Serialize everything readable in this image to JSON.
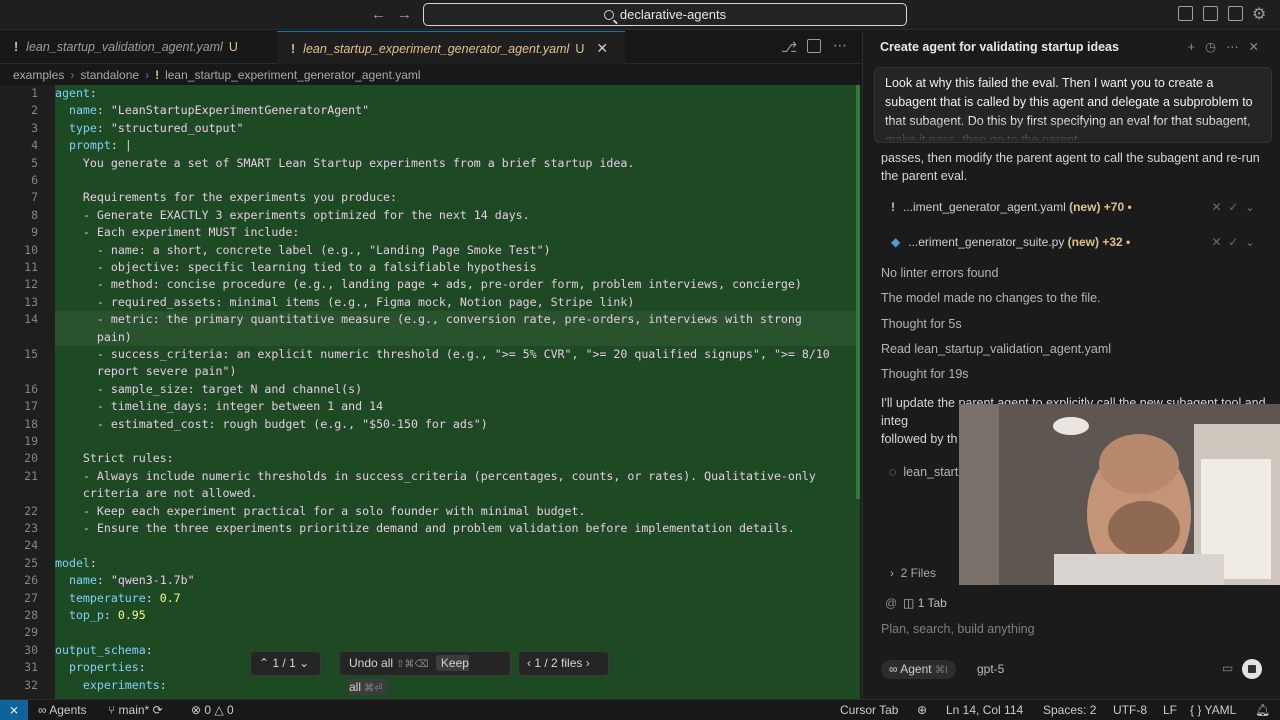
{
  "titlebar": {
    "search_text": "declarative-agents"
  },
  "tabs": [
    {
      "label": "lean_startup_validation_agent.yaml",
      "badge": "U"
    },
    {
      "label": "lean_startup_experiment_generator_agent.yaml",
      "badge": "U"
    }
  ],
  "breadcrumb": {
    "part1": "examples",
    "part2": "standalone",
    "file": "lean_startup_experiment_generator_agent.yaml"
  },
  "code_lines": [
    {
      "n": "1",
      "t": "agent:"
    },
    {
      "n": "2",
      "t": "  name: \"LeanStartupExperimentGeneratorAgent\""
    },
    {
      "n": "3",
      "t": "  type: \"structured_output\""
    },
    {
      "n": "4",
      "t": "  prompt: |"
    },
    {
      "n": "5",
      "t": "    You generate a set of SMART Lean Startup experiments from a brief startup idea."
    },
    {
      "n": "6",
      "t": ""
    },
    {
      "n": "7",
      "t": "    Requirements for the experiments you produce:"
    },
    {
      "n": "8",
      "t": "    - Generate EXACTLY 3 experiments optimized for the next 14 days."
    },
    {
      "n": "9",
      "t": "    - Each experiment MUST include:"
    },
    {
      "n": "10",
      "t": "      - name: a short, concrete label (e.g., \"Landing Page Smoke Test\")"
    },
    {
      "n": "11",
      "t": "      - objective: specific learning tied to a falsifiable hypothesis"
    },
    {
      "n": "12",
      "t": "      - method: concise procedure (e.g., landing page + ads, pre-order form, problem interviews, concierge)"
    },
    {
      "n": "13",
      "t": "      - required_assets: minimal items (e.g., Figma mock, Notion page, Stripe link)"
    },
    {
      "n": "14",
      "t": "      - metric: the primary quantitative measure (e.g., conversion rate, pre-orders, interviews with strong"
    },
    {
      "n": "",
      "t": "      pain)"
    },
    {
      "n": "15",
      "t": "      - success_criteria: an explicit numeric threshold (e.g., \">= 5% CVR\", \">= 20 qualified signups\", \">= 8/10"
    },
    {
      "n": "",
      "t": "      report severe pain\")"
    },
    {
      "n": "16",
      "t": "      - sample_size: target N and channel(s)"
    },
    {
      "n": "17",
      "t": "      - timeline_days: integer between 1 and 14"
    },
    {
      "n": "18",
      "t": "      - estimated_cost: rough budget (e.g., \"$50-150 for ads\")"
    },
    {
      "n": "19",
      "t": ""
    },
    {
      "n": "20",
      "t": "    Strict rules:"
    },
    {
      "n": "21",
      "t": "    - Always include numeric thresholds in success_criteria (percentages, counts, or rates). Qualitative-only"
    },
    {
      "n": "",
      "t": "    criteria are not allowed."
    },
    {
      "n": "22",
      "t": "    - Keep each experiment practical for a solo founder with minimal budget."
    },
    {
      "n": "23",
      "t": "    - Ensure the three experiments prioritize demand and problem validation before implementation details."
    },
    {
      "n": "24",
      "t": ""
    },
    {
      "n": "25",
      "t": "model:"
    },
    {
      "n": "26",
      "t": "  name: \"qwen3-1.7b\""
    },
    {
      "n": "27",
      "t": "  temperature: 0.7"
    },
    {
      "n": "28",
      "t": "  top_p: 0.95"
    },
    {
      "n": "29",
      "t": ""
    },
    {
      "n": "30",
      "t": "output_schema:"
    },
    {
      "n": "31",
      "t": "  properties:"
    },
    {
      "n": "32",
      "t": "    experiments:"
    }
  ],
  "review_bar": {
    "hunks": "1 / 1",
    "undo": "Undo all",
    "undo_kbd": "⇧⌘⌫",
    "keep": "Keep all",
    "keep_kbd": "⌘⏎",
    "files": "1 / 2 files"
  },
  "chat": {
    "title": "Create agent for validating startup ideas",
    "user_message": "Look at why this failed the eval. Then I want you to create a subagent that is called by this agent and delegate a subproblem to that subagent. Do this by first specifying an eval for that subagent, make it pass, then go to the parent",
    "continued": "passes, then modify the parent agent to call the subagent and re-run the parent eval.",
    "files": [
      {
        "name": "...iment_generator_agent.yaml",
        "status": "(new) +70 •"
      },
      {
        "name": "...eriment_generator_suite.py",
        "status": "(new) +32 •"
      }
    ],
    "events": [
      "No linter errors found",
      "The model made no changes to the file.",
      "Thought for 5s",
      "Read lean_startup_validation_agent.yaml",
      "Thought for 19s"
    ],
    "partial_text": "I'll update the parent agent to explicitly call the new subagent tool and integ",
    "partial_text2": "followed by th",
    "running_item": "lean_start",
    "files_count": "2 Files",
    "tab_count": "1 Tab",
    "placeholder": "Plan, search, build anything",
    "agent_label": "Agent",
    "agent_kbd": "⌘I",
    "model_label": "gpt-5"
  },
  "status": {
    "agents": "Agents",
    "branch": "main*",
    "errors": "0",
    "warnings": "0",
    "cursor_tab": "Cursor Tab",
    "position": "Ln 14, Col 114",
    "spaces": "Spaces: 2",
    "encoding": "UTF-8",
    "eol": "LF",
    "language": "YAML"
  },
  "colors": {
    "accent": "#0078d4",
    "diff_green": "#1d4a22",
    "modified": "#e2c08d"
  }
}
